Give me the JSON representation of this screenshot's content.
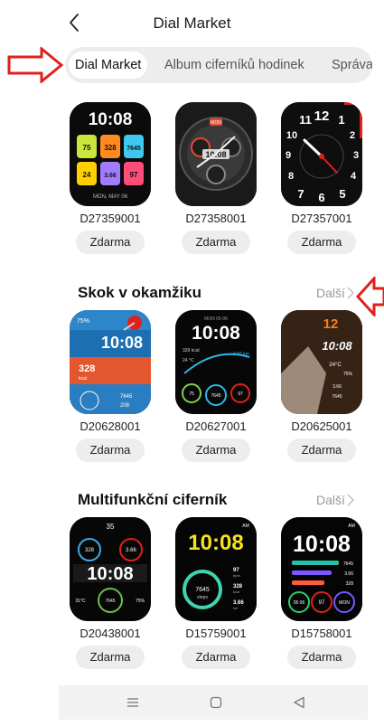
{
  "header": {
    "title": "Dial Market"
  },
  "tabs": [
    {
      "label": "Dial Market",
      "active": true
    },
    {
      "label": "Album ciferníků hodinek",
      "active": false
    },
    {
      "label": "Správa",
      "active": false
    }
  ],
  "featured": {
    "cards": [
      {
        "id": "D27359001",
        "button": "Zdarma",
        "face": {
          "time": "10:08",
          "date": "MON, MAY 06",
          "tiles": [
            "75",
            "328",
            "7645",
            "24",
            "3.66",
            "97"
          ]
        }
      },
      {
        "id": "D27358001",
        "button": "Zdarma",
        "face": {
          "time": "10:08",
          "label": "MON"
        }
      },
      {
        "id": "D27357001",
        "button": "Zdarma",
        "face": {
          "numerals": [
            "11",
            "12",
            "1",
            "10",
            "2",
            "9",
            "3",
            "8",
            "4",
            "7",
            "6",
            "5"
          ]
        }
      }
    ]
  },
  "section_instant": {
    "title": "Skok v okamžiku",
    "more": "Další",
    "cards": [
      {
        "id": "D20628001",
        "button": "Zdarma",
        "face": {
          "time": "10:08",
          "top": "75%",
          "steps": "328",
          "steps_unit": "kcal",
          "bottom1": "7645",
          "bottom2": "208"
        }
      },
      {
        "id": "D20627001",
        "button": "Zdarma",
        "face": {
          "date": "MON 05-06",
          "time": "10:08",
          "line1": "328 kcal",
          "line2": "24 °C",
          "distance": "3.66 km",
          "gauge1": "75",
          "gauge2": "7645",
          "gauge3": "97"
        }
      },
      {
        "id": "D20625001",
        "button": "Zdarma",
        "face": {
          "hour": "12",
          "time": "10:08",
          "temp": "24°C",
          "pct": "75%",
          "dist": "3.66",
          "steps": "7645"
        }
      }
    ]
  },
  "section_multi": {
    "title": "Multifunkční ciferník",
    "more": "Další",
    "cards": [
      {
        "id": "D20438001",
        "button": "Zdarma",
        "face": {
          "time": "10:08",
          "top": "35",
          "left": "328",
          "right": "3.66",
          "bottom_left": "31°C",
          "bottom_right": "75%",
          "center": "7645"
        }
      },
      {
        "id": "D15759001",
        "button": "Zdarma",
        "face": {
          "time": "10:08",
          "ampm": "AM",
          "steps": "7645",
          "steps_unit": "steps",
          "heart": "97",
          "heart_unit": "bpm",
          "kcal": "328",
          "kcal_unit": "kcal",
          "km": "3.66",
          "km_unit": "km"
        }
      },
      {
        "id": "D15758001",
        "button": "Zdarma",
        "face": {
          "time": "10:08",
          "ampm": "AM",
          "bar1": "7645",
          "bar2": "3.66",
          "bar3": "328",
          "ring1": "05 06",
          "ring2": "97",
          "ring3": "MON"
        }
      }
    ]
  },
  "colors": {
    "accent_red": "#e0201b",
    "pill": "#ededed",
    "muted": "#999999"
  },
  "icons": {
    "back": "chevron-left-icon",
    "more": "chevron-right-icon",
    "nav": [
      "menu-icon",
      "home-icon",
      "back-triangle-icon"
    ]
  }
}
